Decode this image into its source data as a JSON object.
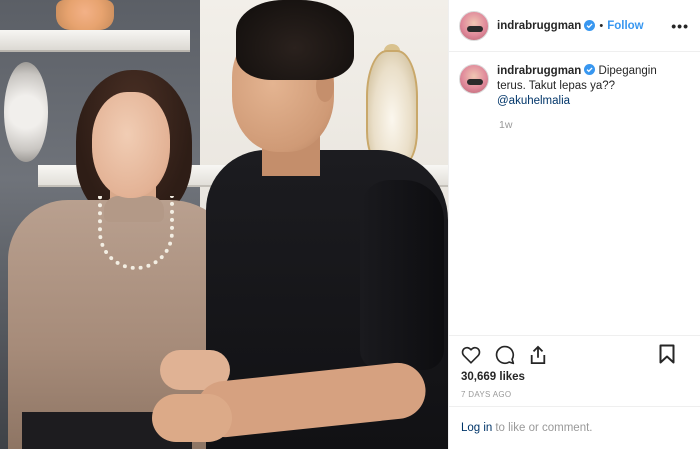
{
  "post": {
    "username": "indrabruggman",
    "follow_label": "Follow",
    "separator": "•",
    "more_label": "•••",
    "caption_username": "indrabruggman",
    "caption_text": " Dipegangin terus. Takut lepas ya?? ",
    "caption_mention": "@akuhelmalia",
    "age": "1w",
    "likes": "30,669 likes",
    "date": "7 DAYS AGO",
    "login_link": "Log in",
    "login_text": "to like or comment."
  },
  "icons": {
    "verified": "verified-badge-icon",
    "like": "heart-icon",
    "comment": "comment-bubble-icon",
    "share": "share-icon",
    "save": "bookmark-icon",
    "more": "more-options-icon"
  },
  "colors": {
    "link_blue": "#3897f0",
    "mention_blue": "#003569",
    "muted_gray": "#999999",
    "text": "#262626",
    "border": "#efefef"
  }
}
